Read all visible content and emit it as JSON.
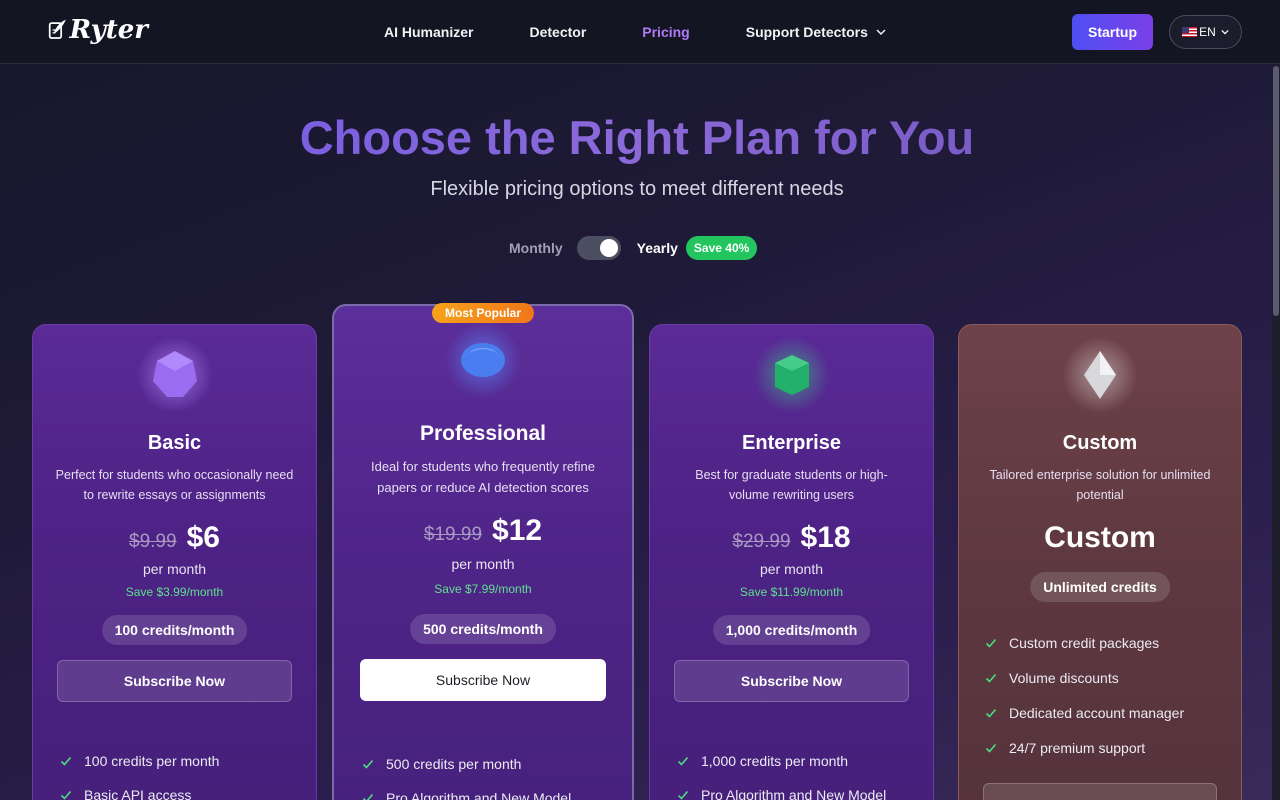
{
  "nav": {
    "logo_text": "Ryter",
    "links": [
      {
        "label": "AI Humanizer",
        "active": false
      },
      {
        "label": "Detector",
        "active": false
      },
      {
        "label": "Pricing",
        "active": true
      },
      {
        "label": "Support Detectors",
        "active": false,
        "dropdown": true
      }
    ],
    "startup_label": "Startup",
    "language": "EN"
  },
  "hero": {
    "title": "Choose the Right Plan for You",
    "subtitle": "Flexible pricing options to meet different needs"
  },
  "billing": {
    "monthly_label": "Monthly",
    "yearly_label": "Yearly",
    "save_badge": "Save 40%",
    "selected": "Yearly"
  },
  "plans": [
    {
      "name": "Basic",
      "description": "Perfect for students who occasionally need to rewrite essays or assignments",
      "old_price": "$9.99",
      "price": "$6",
      "period": "per month",
      "savings": "Save $3.99/month",
      "credits": "100 credits/month",
      "button": "Subscribe Now",
      "features": [
        "100 credits per month",
        "Basic API access"
      ],
      "gem_color": "#9a6cf0"
    },
    {
      "name": "Professional",
      "badge": "Most Popular",
      "description": "Ideal for students who frequently refine papers or reduce AI detection scores",
      "old_price": "$19.99",
      "price": "$12",
      "period": "per month",
      "savings": "Save $7.99/month",
      "credits": "500 credits/month",
      "button": "Subscribe Now",
      "features": [
        "500 credits per month",
        "Pro Algorithm and New Model"
      ],
      "gem_color": "#4a7ef0"
    },
    {
      "name": "Enterprise",
      "description": "Best for graduate students or high-volume rewriting users",
      "old_price": "$29.99",
      "price": "$18",
      "period": "per month",
      "savings": "Save $11.99/month",
      "credits": "1,000 credits/month",
      "button": "Subscribe Now",
      "features": [
        "1,000 credits per month",
        "Pro Algorithm and New Model"
      ],
      "gem_color": "#22b06a"
    },
    {
      "name": "Custom",
      "description": "Tailored enterprise solution for unlimited potential",
      "price": "Custom",
      "credits": "Unlimited credits",
      "features": [
        "Custom credit packages",
        "Volume discounts",
        "Dedicated account manager",
        "24/7 premium support"
      ],
      "gem_color": "#d8d8dc"
    }
  ]
}
